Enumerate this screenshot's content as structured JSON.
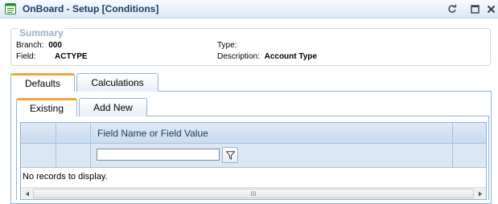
{
  "window": {
    "title": "OnBoard - Setup [Conditions]",
    "icons": [
      "app-icon",
      "refresh-icon",
      "maximize-icon",
      "close-icon"
    ]
  },
  "summary": {
    "legend": "Summary",
    "branch_label": "Branch:",
    "branch_value": "000",
    "field_label": "Field:",
    "field_value": "ACTYPE",
    "type_label": "Type:",
    "type_value": "",
    "description_label": "Description:",
    "description_value": "Account Type"
  },
  "tabs": [
    {
      "label": "Defaults",
      "active": true
    },
    {
      "label": "Calculations",
      "active": false
    }
  ],
  "subtabs": [
    {
      "label": "Existing",
      "active": true
    },
    {
      "label": "Add New",
      "active": false
    }
  ],
  "grid": {
    "column_header": "Field Name or Field Value",
    "filter_value": "",
    "empty_text": "No records to display.",
    "scroll_thumb_glyph": "III"
  },
  "colors": {
    "accent_tab": "#f3a53a",
    "header_text": "#1f3c63",
    "border": "#8fb4d8"
  }
}
